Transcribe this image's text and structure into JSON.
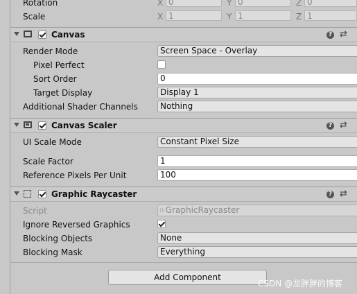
{
  "transform": {
    "rotation": {
      "label": "Rotation",
      "x": "0",
      "y": "0",
      "z": "0"
    },
    "scale": {
      "label": "Scale",
      "x": "1",
      "y": "1",
      "z": "1"
    },
    "axes": {
      "x": "X",
      "y": "Y",
      "z": "Z"
    }
  },
  "canvas": {
    "title": "Canvas",
    "render_mode": {
      "label": "Render Mode",
      "value": "Screen Space - Overlay"
    },
    "pixel_perfect": {
      "label": "Pixel Perfect",
      "checked": false
    },
    "sort_order": {
      "label": "Sort Order",
      "value": "0"
    },
    "target_display": {
      "label": "Target Display",
      "value": "Display 1"
    },
    "additional_shader_channels": {
      "label": "Additional Shader Channels",
      "value": "Nothing"
    }
  },
  "canvas_scaler": {
    "title": "Canvas Scaler",
    "ui_scale_mode": {
      "label": "UI Scale Mode",
      "value": "Constant Pixel Size"
    },
    "scale_factor": {
      "label": "Scale Factor",
      "value": "1"
    },
    "reference_pixels_per_unit": {
      "label": "Reference Pixels Per Unit",
      "value": "100"
    }
  },
  "graphic_raycaster": {
    "title": "Graphic Raycaster",
    "script": {
      "label": "Script",
      "value": "GraphicRaycaster"
    },
    "ignore_reversed_graphics": {
      "label": "Ignore Reversed Graphics",
      "checked": true
    },
    "blocking_objects": {
      "label": "Blocking Objects",
      "value": "None"
    },
    "blocking_mask": {
      "label": "Blocking Mask",
      "value": "Everything"
    }
  },
  "header_icons": {
    "help": "?",
    "preset": "⇄",
    "more": "⋮"
  },
  "add_component": "Add Component",
  "watermark": "CSDN @龙胖胖的博客"
}
